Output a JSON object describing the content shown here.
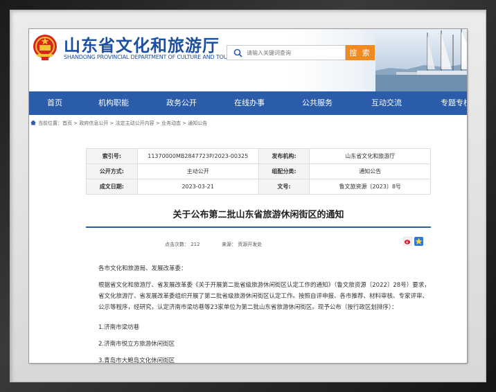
{
  "header": {
    "site_title": "山东省文化和旅游厅",
    "site_subtitle": "SHANDONG PROVINCIAL DEPARTMENT OF CULTURE AND TOURISM",
    "search_placeholder": "请输入关键词查询",
    "search_button": "搜 索"
  },
  "nav": {
    "items": [
      {
        "label": "首页"
      },
      {
        "label": "机构职能"
      },
      {
        "label": "政务公开"
      },
      {
        "label": "在线办事"
      },
      {
        "label": "公共服务"
      },
      {
        "label": "互动交流"
      },
      {
        "label": "专题专栏"
      }
    ]
  },
  "breadcrumb": {
    "text": "当前位置：首页 > 政府信息公开 > 法定主动公开内容 > 业务动态 > 通知公告"
  },
  "meta": {
    "index_label": "索引号:",
    "index_value": "11370000MB2847723P/2023-00325",
    "publisher_label": "发布机构:",
    "publisher_value": "山东省文化和旅游厅",
    "mode_label": "公开方式:",
    "mode_value": "主动公开",
    "category_label": "组配分类:",
    "category_value": "通知公告",
    "date_label": "成文日期:",
    "date_value": "2023-03-21",
    "doc_label": "文号:",
    "doc_value": "鲁文旅资源〔2023〕8号"
  },
  "article": {
    "title": "关于公布第二批山东省旅游休闲街区的通知",
    "clicks": "点击次数： 212",
    "source": "来源： 资源开发处",
    "salutation": "各市文化和旅游局、发展改革委：",
    "body": "根据省文化和旅游厅、省发展改革委《关于开展第二批省级旅游休闲街区认定工作的通知》（鲁文旅资源〔2022〕28号）要求，省文化旅游厅、省发展改革委组织开展了第二批省级旅游休闲街区认定工作。按照自评申报、各市推荐、材料审核、专家评审、公示等程序，经研究，认定济南市梁坊巷等23家单位为第二批山东省旅游休闲街区。现予公布（按行政区划排序）：",
    "items": [
      "1.济南市梁坊巷",
      "2.济南市悦立方旅游休闲街区",
      "3.青岛市大鲍岛文化休闲街区"
    ]
  },
  "colors": {
    "brand_blue": "#2a5caa",
    "title_blue": "#1d4fa0",
    "search_orange": "#f18a1f"
  }
}
